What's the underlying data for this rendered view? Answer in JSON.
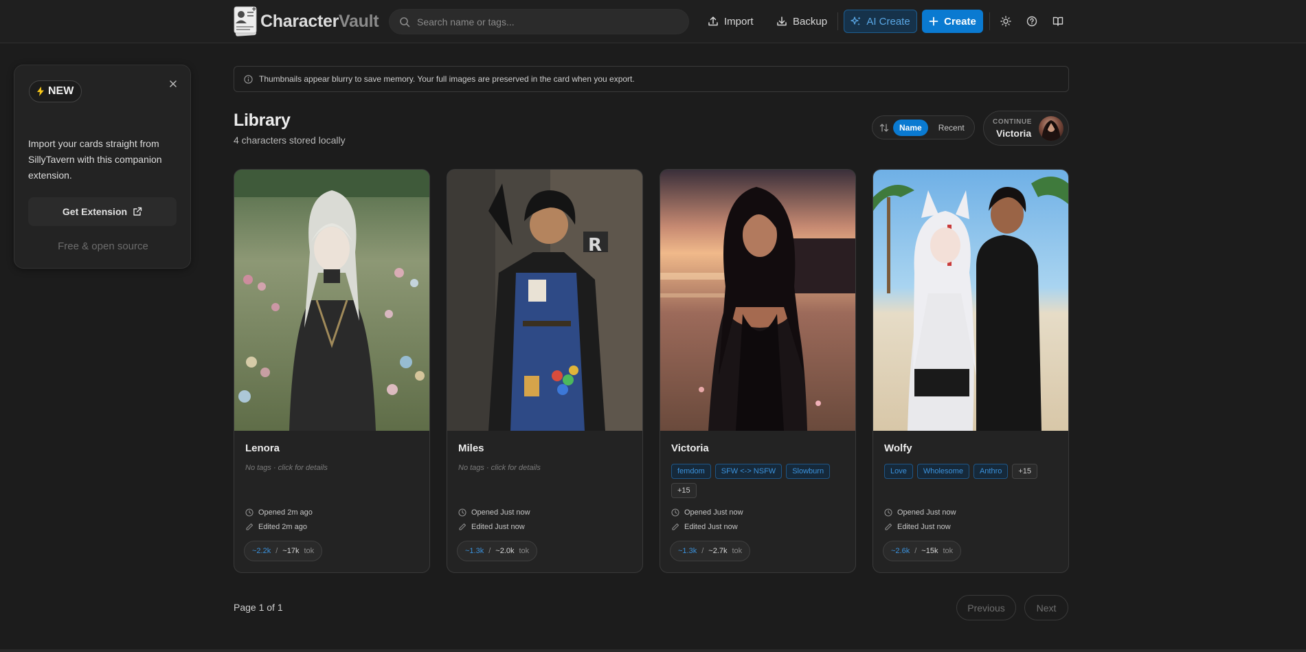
{
  "app": {
    "logo_part1": "Character",
    "logo_part2": "Vault"
  },
  "header": {
    "search_placeholder": "Search name or tags...",
    "import_label": "Import",
    "backup_label": "Backup",
    "ai_create_label": "AI Create",
    "create_label": "Create"
  },
  "promo": {
    "badge": "NEW",
    "text": "Import your cards straight from SillyTavern with this companion extension.",
    "button_label": "Get Extension",
    "footer": "Free & open source"
  },
  "notice": {
    "text": "Thumbnails appear blurry to save memory. Your full images are preserved in the card when you export."
  },
  "library": {
    "title": "Library",
    "subtitle": "4 characters stored locally",
    "sort_name": "Name",
    "sort_recent": "Recent",
    "continue_label": "CONTINUE",
    "continue_name": "Victoria"
  },
  "cards": [
    {
      "name": "Lenora",
      "no_tags": "No tags · click for details",
      "tags": [],
      "opened": "Opened 2m ago",
      "edited": "Edited 2m ago",
      "tok_a": "~2.2k",
      "tok_sep": "/",
      "tok_b": "~17k",
      "tok_unit": "tok"
    },
    {
      "name": "Miles",
      "no_tags": "No tags · click for details",
      "tags": [],
      "opened": "Opened Just now",
      "edited": "Edited Just now",
      "tok_a": "~1.3k",
      "tok_sep": "/",
      "tok_b": "~2.0k",
      "tok_unit": "tok"
    },
    {
      "name": "Victoria",
      "tags": [
        "femdom",
        "SFW <-> NSFW",
        "Slowburn"
      ],
      "more": "+15",
      "opened": "Opened Just now",
      "edited": "Edited Just now",
      "tok_a": "~1.3k",
      "tok_sep": "/",
      "tok_b": "~2.7k",
      "tok_unit": "tok"
    },
    {
      "name": "Wolfy",
      "tags": [
        "Love",
        "Wholesome",
        "Anthro"
      ],
      "more": "+15",
      "opened": "Opened Just now",
      "edited": "Edited Just now",
      "tok_a": "~2.6k",
      "tok_sep": "/",
      "tok_b": "~15k",
      "tok_unit": "tok"
    }
  ],
  "pagination": {
    "info": "Page 1 of 1",
    "previous": "Previous",
    "next": "Next"
  },
  "colors": {
    "accent": "#0a7ad1",
    "tag_text": "#3b93de",
    "background": "#1c1c1c"
  }
}
